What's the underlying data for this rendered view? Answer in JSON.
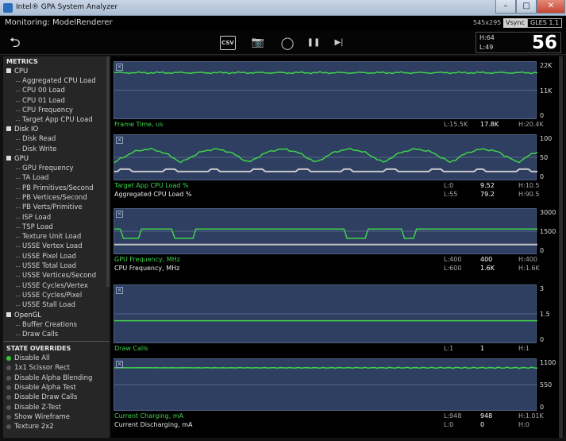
{
  "window": {
    "title": "Intel® GPA System Analyzer",
    "minimize": "–",
    "maximize": "□",
    "close": "✕"
  },
  "header": {
    "monitoring": "Monitoring: ModelRenderer",
    "resolution": "545x295",
    "vsync": "Vsync",
    "api": "GLES 1.1"
  },
  "toolbar": {
    "back_icon": "⮌",
    "csv_label": "CSV",
    "camera_icon": "📷",
    "record_icon": "◯",
    "pause_icon": "❚❚",
    "step_icon": "▶|"
  },
  "fps": {
    "high": "H:64",
    "low": "L:49",
    "value": "56"
  },
  "sidebar": {
    "metrics_header": "METRICS",
    "groups": [
      {
        "label": "CPU",
        "items": [
          "Aggregated CPU Load",
          "CPU 00 Load",
          "CPU 01 Load",
          "CPU Frequency",
          "Target App CPU Load"
        ]
      },
      {
        "label": "Disk IO",
        "items": [
          "Disk Read",
          "Disk Write"
        ]
      },
      {
        "label": "GPU",
        "items": [
          "GPU Frequency",
          "TA Load",
          "PB Primitives/Second",
          "PB Vertices/Second",
          "PB Verts/Primitive",
          "ISP Load",
          "TSP Load",
          "Texture Unit Load",
          "USSE Vertex Load",
          "USSE Pixel Load",
          "USSE Total Load",
          "USSE Vertices/Second",
          "USSE Cycles/Vertex",
          "USSE Cycles/Pixel",
          "USSE Stall Load"
        ]
      },
      {
        "label": "OpenGL",
        "items": [
          "Buffer Creations",
          "Draw Calls"
        ]
      }
    ],
    "overrides_header": "STATE OVERRIDES",
    "overrides": [
      {
        "label": "Disable All",
        "active": true
      },
      {
        "label": "1x1 Scissor Rect",
        "active": false
      },
      {
        "label": "Disable Alpha Blending",
        "active": false
      },
      {
        "label": "Disable Alpha Test",
        "active": false
      },
      {
        "label": "Disable Draw Calls",
        "active": false
      },
      {
        "label": "Disable Z-Test",
        "active": false
      },
      {
        "label": "Show Wireframe",
        "active": false
      },
      {
        "label": "Texture 2x2",
        "active": false
      }
    ]
  },
  "graphs": [
    {
      "yticks": [
        "22K",
        "11K",
        "0"
      ],
      "rows": [
        {
          "label": "Frame Time, us",
          "low": "L:15.5K",
          "current": "17.8K",
          "high": "H:20.4K",
          "color": "green"
        }
      ]
    },
    {
      "yticks": [
        "100",
        "50",
        "0"
      ],
      "rows": [
        {
          "label": "Target App CPU Load %",
          "low": "L:0",
          "current": "9.52",
          "high": "H:10.5",
          "color": "green"
        },
        {
          "label": "Aggregated CPU Load %",
          "low": "L:55",
          "current": "79.2",
          "high": "H:90.5",
          "color": "white"
        }
      ]
    },
    {
      "yticks": [
        "3000",
        "1500",
        "0"
      ],
      "rows": [
        {
          "label": "GPU Frequency, MHz",
          "low": "L:400",
          "current": "400",
          "high": "H:400",
          "color": "green"
        },
        {
          "label": "CPU Frequency, MHz",
          "low": "L:600",
          "current": "1.6K",
          "high": "H:1.6K",
          "color": "white"
        }
      ]
    },
    {
      "yticks": [
        "3",
        "1.5",
        "0"
      ],
      "rows": [
        {
          "label": "Draw Calls",
          "low": "L:1",
          "current": "1",
          "high": "H:1",
          "color": "green"
        }
      ]
    },
    {
      "yticks": [
        "1100",
        "550",
        "0"
      ],
      "rows": [
        {
          "label": "Current Charging, mA",
          "low": "L:948",
          "current": "948",
          "high": "H:1.01K",
          "color": "green"
        },
        {
          "label": "Current Discharging, mA",
          "low": "L:0",
          "current": "0",
          "high": "H:0",
          "color": "white"
        }
      ]
    }
  ],
  "colors": {
    "plot_bg": "#2f3f62",
    "green_series": "#3fd24a",
    "white_series": "#c8c8c8"
  }
}
